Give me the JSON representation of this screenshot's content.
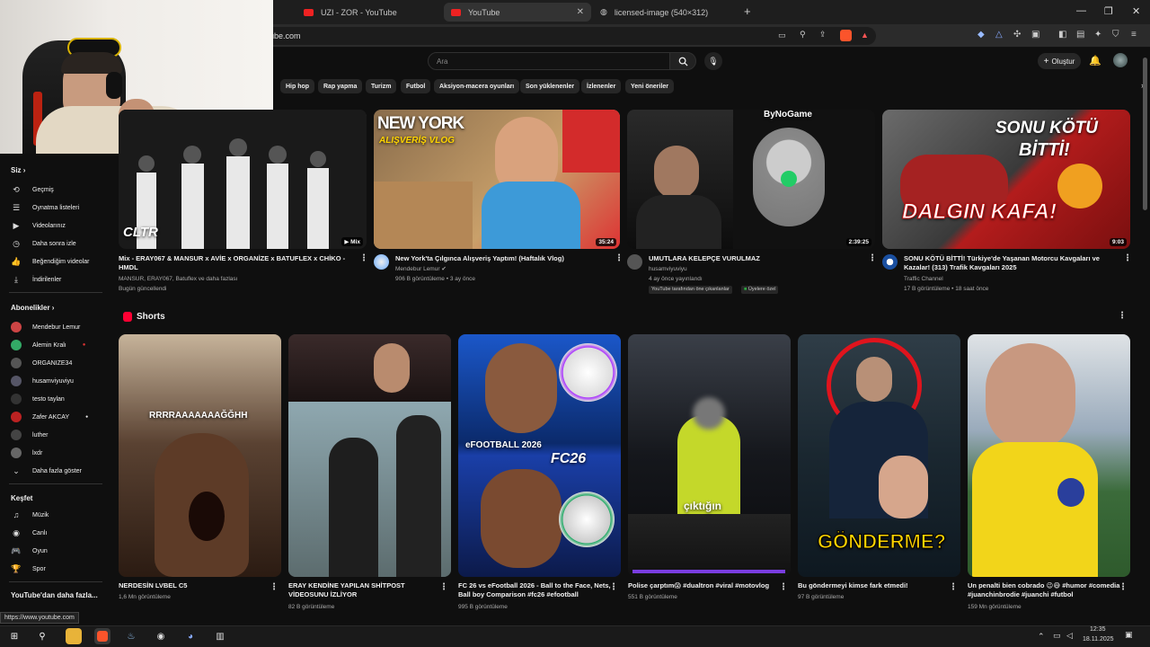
{
  "browser": {
    "tabs": [
      {
        "label": "UZI - ZOR - YouTube"
      },
      {
        "label": "YouTube"
      },
      {
        "label": "licensed-image (540×312)"
      }
    ],
    "url": "ube.com",
    "new_tab": "+"
  },
  "youtube": {
    "search_placeholder": "Ara",
    "create_label": "Oluştur",
    "chips": [
      "Hip hop",
      "Rap yapma",
      "Turizm",
      "Futbol",
      "Aksiyon-macera oyunları",
      "Son yüklenenler",
      "İzlenenler",
      "Yeni öneriler"
    ]
  },
  "sidebar": {
    "you_header": "Siz",
    "you_items": [
      {
        "label": "Geçmiş",
        "icon": "history-icon"
      },
      {
        "label": "Oynatma listeleri",
        "icon": "playlist-icon"
      },
      {
        "label": "Videolarınız",
        "icon": "your-videos-icon"
      },
      {
        "label": "Daha sonra izle",
        "icon": "watch-later-icon"
      },
      {
        "label": "Beğendiğim videolar",
        "icon": "like-icon"
      },
      {
        "label": "İndirilenler",
        "icon": "download-icon"
      }
    ],
    "subs_header": "Abonelikler",
    "subs": [
      {
        "label": "Mendebur Lemur",
        "color": "#c44"
      },
      {
        "label": "Alemin Kralı",
        "color": "#3a6"
      },
      {
        "label": "ORGANIZE34",
        "color": "#555"
      },
      {
        "label": "husamviyuviyu",
        "color": "#556"
      },
      {
        "label": "testo taylan",
        "color": "#333"
      },
      {
        "label": "Zafer AKCAY",
        "color": "#b22"
      },
      {
        "label": "luther",
        "color": "#444"
      },
      {
        "label": "lxdr",
        "color": "#666"
      }
    ],
    "more": "Daha fazla göster",
    "explore_header": "Keşfet",
    "explore": [
      {
        "label": "Müzik",
        "icon": "music-icon"
      },
      {
        "label": "Canlı",
        "icon": "live-icon"
      },
      {
        "label": "Oyun",
        "icon": "gaming-icon"
      },
      {
        "label": "Spor",
        "icon": "trophy-icon"
      }
    ],
    "more_from": "YouTube'dan daha fazla..."
  },
  "videos": [
    {
      "title": "Mix - ERAY067 & MANSUR x AVİE x ORGANİZE x BATUFLEX x CHİKO - HMDL",
      "meta1": "MANSUR, ERAY067, Batuflex ve daha fazlası",
      "meta2": "Bugün güncellendi",
      "badge": "Mix",
      "overlay": "CLTR"
    },
    {
      "title": "New York'ta Çılgınca Alışveriş Yaptım! (Haftalık Vlog)",
      "meta1": "Mendebur Lemur",
      "meta2": "906 B görüntüleme • 3 ay önce",
      "dur": "35:24",
      "overlay": "NEW YORK",
      "overlay2": "ALIŞVERİŞ VLOG"
    },
    {
      "title": "UMUTLARA KELEPÇE VURULMAZ",
      "meta1": "husamviyuviyu",
      "meta2": "4 ay önce yayınlandı",
      "tag1": "YouTube tarafından öne çıkanlanlar",
      "tag2": "Üyelere özel",
      "dur": "2:39:25",
      "overlay": "ByNoGame"
    },
    {
      "title": "SONU KÖTÜ BİTTİ! Türkiye'de Yaşanan Motorcu Kavgaları ve Kazalar! (313) Trafik Kavgaları 2025",
      "meta1": "Traffic Channel",
      "meta2": "17 B görüntüleme • 18 saat önce",
      "dur": "9:03",
      "overlay": "SONU KÖTÜ",
      "overlay2": "BİTTİ!",
      "overlay3": "DALGIN KAFA!"
    }
  ],
  "shorts_header": "Shorts",
  "shorts": [
    {
      "title": "NERDESİN LVBEL C5",
      "views": "1,6 Mn görüntüleme",
      "overlay": "RRRRAAAAAAAĞĞHH"
    },
    {
      "title": "ERAY KENDİNE YAPILAN SHİTPOST VİDEOSUNU İZLİYOR",
      "views": "82 B görüntüleme"
    },
    {
      "title": "FC 26 vs eFootball 2026 - Ball to the Face, Nets, Ball boy Comparison #fc26 #efootball",
      "views": "995 B görüntüleme",
      "overlay": "FC26",
      "overlay2": "eFOOTBALL 2026"
    },
    {
      "title": "Polise çarptım😱 #dualtron #viral #motovlog",
      "views": "551 B görüntüleme",
      "overlay": "çıktığın"
    },
    {
      "title": "Bu göndermeyi kimse fark etmedi!",
      "views": "97 B görüntüleme",
      "overlay": "GÖNDERME?"
    },
    {
      "title": "Un penalti bien cobrado 😉😅 #humor #comedia #juanchinbrodie #juanchi #futbol",
      "views": "159 Mn görüntüleme"
    }
  ],
  "status_url": "https://www.youtube.com",
  "taskbar": {
    "time": "12:35",
    "date": "18.11.2025"
  }
}
